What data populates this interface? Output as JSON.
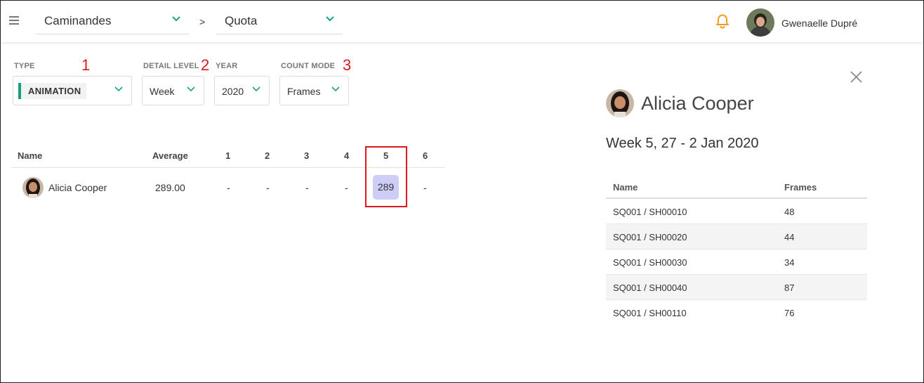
{
  "header": {
    "production": "Caminandes",
    "separator": ">",
    "section": "Quota",
    "user_name": "Gwenaelle Dupré"
  },
  "filters": {
    "type_label": "Type",
    "type_value": "ANIMATION",
    "detail_label": "Detail level",
    "detail_value": "Week",
    "year_label": "Year",
    "year_value": "2020",
    "count_label": "Count mode",
    "count_value": "Frames"
  },
  "annotations": [
    "1",
    "2",
    "3"
  ],
  "table": {
    "columns": [
      "Name",
      "Average",
      "1",
      "2",
      "3",
      "4",
      "5",
      "6"
    ],
    "rows": [
      {
        "name": "Alicia Cooper",
        "average": "289.00",
        "weeks": [
          "-",
          "-",
          "-",
          "-",
          "289",
          "-"
        ]
      }
    ]
  },
  "panel": {
    "person": "Alicia Cooper",
    "week_title": "Week 5, 27 - 2 Jan 2020",
    "columns": [
      "Name",
      "Frames"
    ],
    "rows": [
      [
        "SQ001 / SH00010",
        "48"
      ],
      [
        "SQ001 / SH00020",
        "44"
      ],
      [
        "SQ001 / SH00030",
        "34"
      ],
      [
        "SQ001 / SH00040",
        "87"
      ],
      [
        "SQ001 / SH00110",
        "76"
      ]
    ]
  },
  "colors": {
    "accent_green": "#15a085",
    "bell_orange": "#f29b1d",
    "highlight_cell": "#cdcdf7",
    "annotation_red": "#e0181c"
  },
  "icons": [
    "menu-icon",
    "chevron-down-icon",
    "bell-icon",
    "close-icon",
    "avatar"
  ]
}
